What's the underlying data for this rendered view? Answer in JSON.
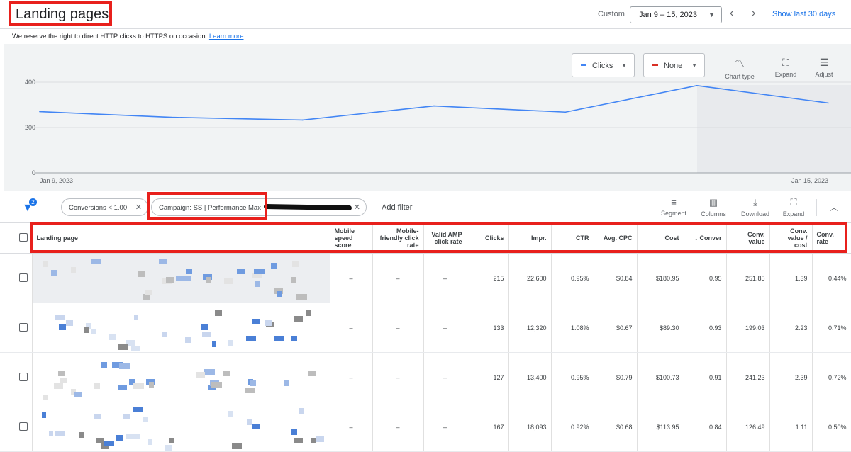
{
  "header": {
    "title": "Landing pages",
    "custom_label": "Custom",
    "date_range": "Jan 9 – 15, 2023",
    "show_last": "Show last 30 days"
  },
  "notice": {
    "text": "We reserve the right to direct HTTP clicks to HTTPS on occasion.",
    "link": "Learn more"
  },
  "chart_controls": {
    "metric1": "Clicks",
    "metric2": "None",
    "chart_type": "Chart type",
    "expand": "Expand",
    "adjust": "Adjust"
  },
  "colors": {
    "accent": "#1a73e8",
    "series": "#4285f4",
    "highlight": "#e8201c",
    "metric2": "#d93025"
  },
  "chart_data": {
    "type": "line",
    "x": [
      "Jan 9, 2023",
      "Jan 10, 2023",
      "Jan 11, 2023",
      "Jan 12, 2023",
      "Jan 13, 2023",
      "Jan 14, 2023",
      "Jan 15, 2023"
    ],
    "series": [
      {
        "values": [
          270,
          245,
          233,
          295,
          268,
          385,
          308
        ]
      }
    ],
    "x_tick_labels": [
      "Jan 9, 2023",
      "Jan 15, 2023"
    ],
    "y_tick_labels": [
      "400",
      "200",
      "0"
    ],
    "ylim": [
      0,
      400
    ],
    "grid": true
  },
  "filters": {
    "count": "2",
    "chips": [
      "Conversions < 1.00",
      "Campaign: SS | Performance Max"
    ],
    "add_filter": "Add filter"
  },
  "table_tools": {
    "segment": "Segment",
    "columns": "Columns",
    "download": "Download",
    "expand": "Expand"
  },
  "table": {
    "columns": [
      "Landing page",
      "Mobile speed score",
      "Mobile-friendly click rate",
      "Valid AMP click rate",
      "Clicks",
      "Impr.",
      "CTR",
      "Avg. CPC",
      "Cost",
      "↓ Conver",
      "Conv. value",
      "Conv. value / cost",
      "Conv. rate"
    ],
    "rows": [
      [
        "–",
        "–",
        "–",
        "215",
        "22,600",
        "0.95%",
        "$0.84",
        "$180.95",
        "0.95",
        "251.85",
        "1.39",
        "0.44%"
      ],
      [
        "–",
        "–",
        "–",
        "133",
        "12,320",
        "1.08%",
        "$0.67",
        "$89.30",
        "0.93",
        "199.03",
        "2.23",
        "0.71%"
      ],
      [
        "–",
        "–",
        "–",
        "127",
        "13,400",
        "0.95%",
        "$0.79",
        "$100.73",
        "0.91",
        "241.23",
        "2.39",
        "0.72%"
      ],
      [
        "–",
        "–",
        "–",
        "167",
        "18,093",
        "0.92%",
        "$0.68",
        "$113.95",
        "0.84",
        "126.49",
        "1.11",
        "0.50%"
      ]
    ]
  }
}
